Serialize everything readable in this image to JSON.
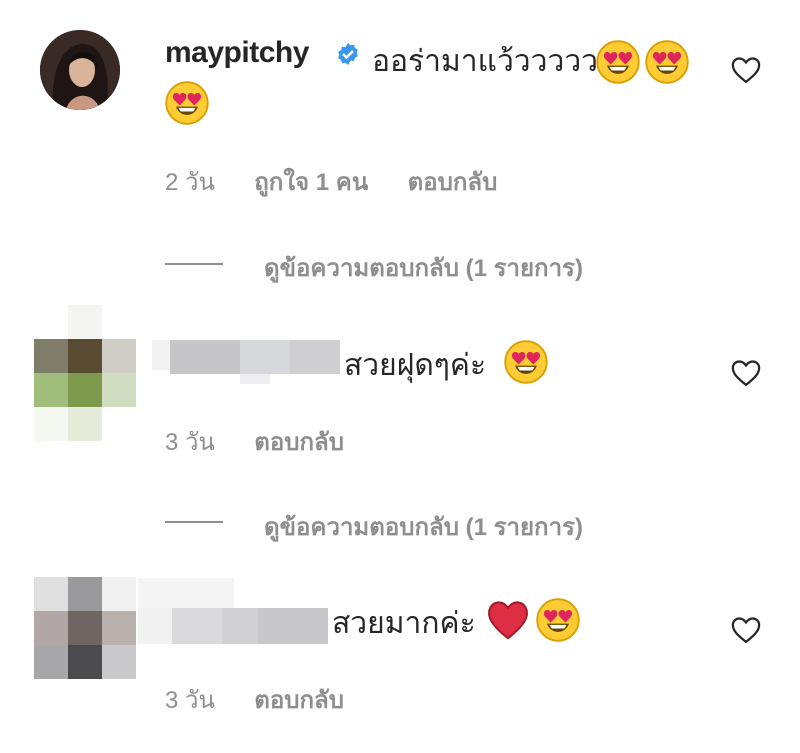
{
  "comments": [
    {
      "username": "maypitchy",
      "verified": true,
      "text": "ออร่ามาแว้ววววว",
      "emojis_inline": [
        "heart-eyes",
        "heart-eyes"
      ],
      "emojis_second_line": [
        "heart-eyes"
      ],
      "age": "2 วัน",
      "likes": "ถูกใจ 1 คน",
      "reply_label": "ตอบกลับ",
      "view_replies": "ดูข้อความตอบกลับ (1 รายการ)"
    },
    {
      "username": "",
      "text": "สวยฝุดๆค่ะ",
      "emojis_inline": [
        "heart-eyes"
      ],
      "age": "3 วัน",
      "reply_label": "ตอบกลับ",
      "view_replies": "ดูข้อความตอบกลับ (1 รายการ)"
    },
    {
      "username": "",
      "text": "สวยมากค่ะ",
      "emojis_inline": [
        "red-heart",
        "heart-eyes"
      ],
      "age": "3 วัน",
      "reply_label": "ตอบกลับ"
    }
  ],
  "icons": {
    "like": "heart-outline-icon",
    "verified": "verified-badge-icon"
  },
  "colors": {
    "text": "#262626",
    "secondary": "#8e8e8e",
    "verified_blue": "#3897f0",
    "emoji_yellow": "#ffcc33",
    "emoji_heart_red": "#e0245e"
  }
}
